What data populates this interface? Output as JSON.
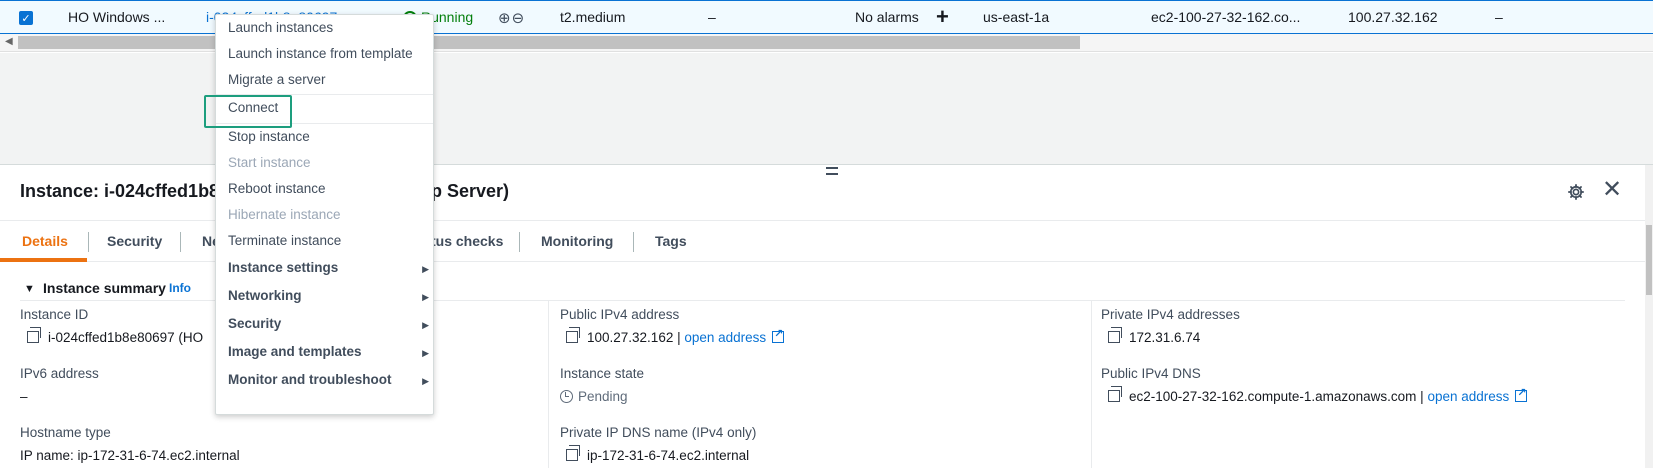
{
  "table_row": {
    "name": "HO Windows ...",
    "instance_id": "i-024cffed1b8e80697",
    "state": "Running",
    "instance_type": "t2.medium",
    "status_check": "–",
    "alarm_status": "No alarms",
    "availability_zone": "us-east-1a",
    "public_dns": "ec2-100-27-32-162.co...",
    "public_ip": "100.27.32.162",
    "elastic_ip": "–"
  },
  "panel": {
    "title_start": "Instance: i-024cffed1b8",
    "title_end": "p Server)",
    "tabs": [
      "Details",
      "Security",
      "Ne",
      "tus checks",
      "Monitoring",
      "Tags"
    ],
    "summary_title": "Instance summary",
    "info": "Info",
    "fields": {
      "instance_id_label": "Instance ID",
      "instance_id_value": "i-024cffed1b8e80697 (HO",
      "ipv6_label": "IPv6 address",
      "ipv6_value": "–",
      "hostname_type_label": "Hostname type",
      "hostname_type_value": "IP name: ip-172-31-6-74.ec2.internal",
      "public_ipv4_label": "Public IPv4 address",
      "public_ipv4_value": "100.27.32.162 |",
      "open_address": "open address",
      "instance_state_label": "Instance state",
      "instance_state_value": "Pending",
      "private_dns_label": "Private IP DNS name (IPv4 only)",
      "private_dns_value": "ip-172-31-6-74.ec2.internal",
      "private_ipv4_label": "Private IPv4 addresses",
      "private_ipv4_value": "172.31.6.74",
      "public_dns_label": "Public IPv4 DNS",
      "public_dns_value": "ec2-100-27-32-162.compute-1.amazonaws.com |",
      "open_address_2": "open address"
    }
  },
  "menu": {
    "items": [
      {
        "label": "Launch instances"
      },
      {
        "label": "Launch instance from template"
      },
      {
        "label": "Migrate a server"
      },
      {
        "label": "Connect"
      },
      {
        "label": "Stop instance"
      },
      {
        "label": "Start instance"
      },
      {
        "label": "Reboot instance"
      },
      {
        "label": "Hibernate instance"
      },
      {
        "label": "Terminate instance"
      },
      {
        "label": "Instance settings"
      },
      {
        "label": "Networking"
      },
      {
        "label": "Security"
      },
      {
        "label": "Image and templates"
      },
      {
        "label": "Monitor and troubleshoot"
      }
    ]
  },
  "colors": {
    "accent": "#0972d3",
    "active_tab": "#ec7211",
    "running": "#037f0c",
    "highlight": "#1d9e7e"
  }
}
